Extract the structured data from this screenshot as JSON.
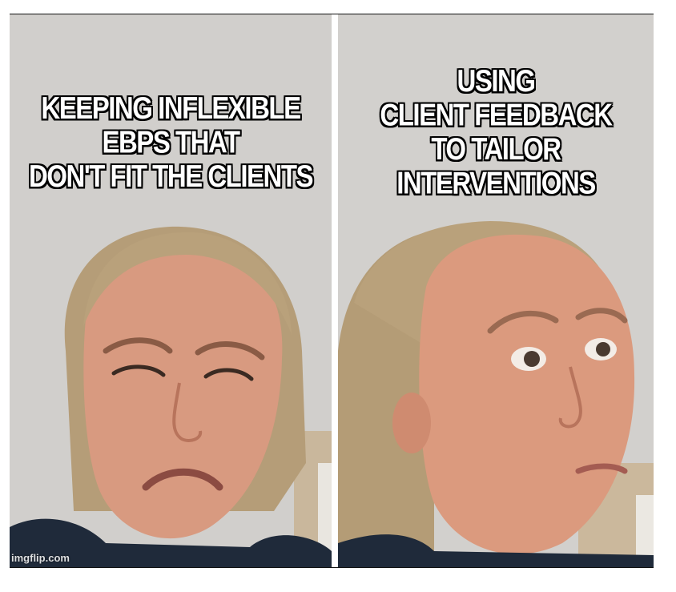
{
  "panels": {
    "left": {
      "caption": "KEEPING INFLEXIBLE\nEBPS THAT\nDON'T FIT THE CLIENTS"
    },
    "right": {
      "caption": "USING\nCLIENT FEEDBACK\nTO TAILOR\nINTERVENTIONS"
    }
  },
  "watermark": "imgflip.com",
  "colors": {
    "caption_fill": "#ffffff",
    "caption_outline": "#000000",
    "wall": "#d0cecb",
    "skin": "#d9967c",
    "hair": "#b8a07a"
  }
}
